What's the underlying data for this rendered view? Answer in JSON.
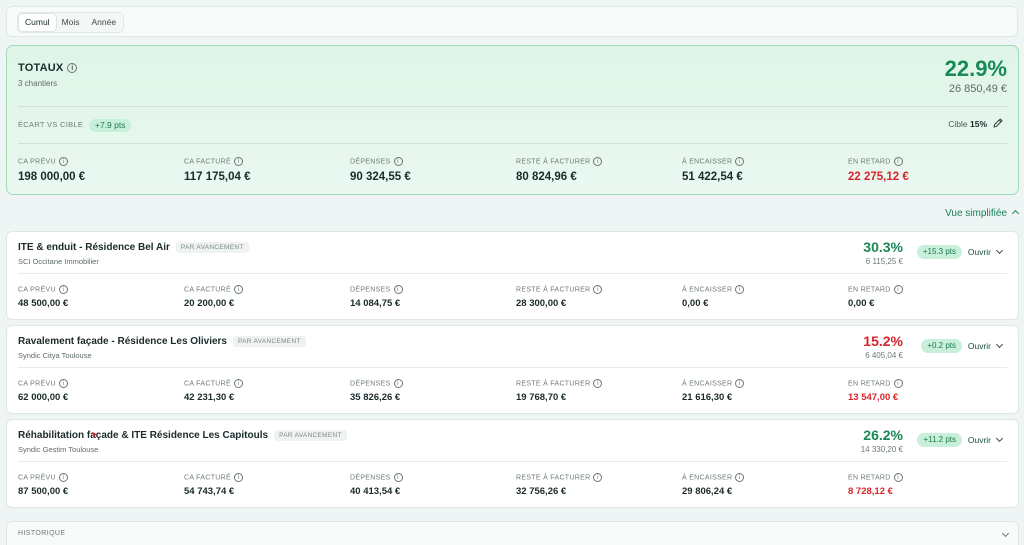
{
  "tabs": [
    "Cumul",
    "Mois",
    "Année"
  ],
  "totals": {
    "title": "TOTAUX",
    "subtitle": "3 chantiers",
    "margin_pct": "22.9%",
    "margin_amount": "26 850,49 €",
    "ecart_label": "ÉCART VS CIBLE",
    "ecart_value": "+7.9 pts",
    "cible_label": "Cible",
    "cible_value": "15%",
    "metrics": [
      {
        "label": "CA PRÉVU",
        "value": "198 000,00 €"
      },
      {
        "label": "CA FACTURÉ",
        "value": "117 175,04 €"
      },
      {
        "label": "DÉPENSES",
        "value": "90 324,55 €"
      },
      {
        "label": "RESTE À FACTURER",
        "value": "80 824,96 €"
      },
      {
        "label": "À ENCAISSER",
        "value": "51 422,54 €"
      },
      {
        "label": "EN RETARD",
        "value": "22 275,12 €"
      }
    ]
  },
  "vue_toggle": "Vue simplifiée",
  "projects": [
    {
      "name": "ITE & enduit - Résidence Bel Air",
      "mode": "PAR AVANCEMENT",
      "client": "SCI Occitane Immobilier",
      "margin_pct": "30.3%",
      "margin_color": "#178a55",
      "margin_amount": "6 115,25 €",
      "delta": "+15.3 pts",
      "open_label": "Ouvrir",
      "metrics": [
        {
          "label": "CA PRÉVU",
          "value": "48 500,00 €"
        },
        {
          "label": "CA FACTURÉ",
          "value": "20 200,00 €"
        },
        {
          "label": "DÉPENSES",
          "value": "14 084,75 €"
        },
        {
          "label": "RESTE À FACTURER",
          "value": "28 300,00 €"
        },
        {
          "label": "À ENCAISSER",
          "value": "0,00 €"
        },
        {
          "label": "EN RETARD",
          "value": "0,00 €"
        }
      ]
    },
    {
      "name": "Ravalement façade - Résidence Les Oliviers",
      "mode": "PAR AVANCEMENT",
      "client": "Syndic Citya Toulouse",
      "margin_pct": "15.2%",
      "margin_color": "#d8232a",
      "margin_amount": "6 405,04 €",
      "delta": "+0.2 pts",
      "open_label": "Ouvrir",
      "metrics": [
        {
          "label": "CA PRÉVU",
          "value": "62 000,00 €"
        },
        {
          "label": "CA FACTURÉ",
          "value": "42 231,30 €"
        },
        {
          "label": "DÉPENSES",
          "value": "35 826,26 €"
        },
        {
          "label": "RESTE À FACTURER",
          "value": "19 768,70 €"
        },
        {
          "label": "À ENCAISSER",
          "value": "21 616,30 €"
        },
        {
          "label": "EN RETARD",
          "value": "13 547,00 €"
        }
      ]
    },
    {
      "name": "Réhabilitation façade & ITE Résidence Les Capitouls",
      "mode": "PAR AVANCEMENT",
      "client": "Syndic Gestim Toulouse",
      "margin_pct": "26.2%",
      "margin_color": "#178a55",
      "margin_amount": "14 330,20 €",
      "delta": "+11.2 pts",
      "open_label": "Ouvrir",
      "metrics": [
        {
          "label": "CA PRÉVU",
          "value": "87 500,00 €"
        },
        {
          "label": "CA FACTURÉ",
          "value": "54 743,74 €"
        },
        {
          "label": "DÉPENSES",
          "value": "40 413,54 €"
        },
        {
          "label": "RESTE À FACTURER",
          "value": "32 756,26 €"
        },
        {
          "label": "À ENCAISSER",
          "value": "29 806,24 €"
        },
        {
          "label": "EN RETARD",
          "value": "8 728,12 €"
        }
      ]
    }
  ],
  "history_label": "HISTORIQUE"
}
